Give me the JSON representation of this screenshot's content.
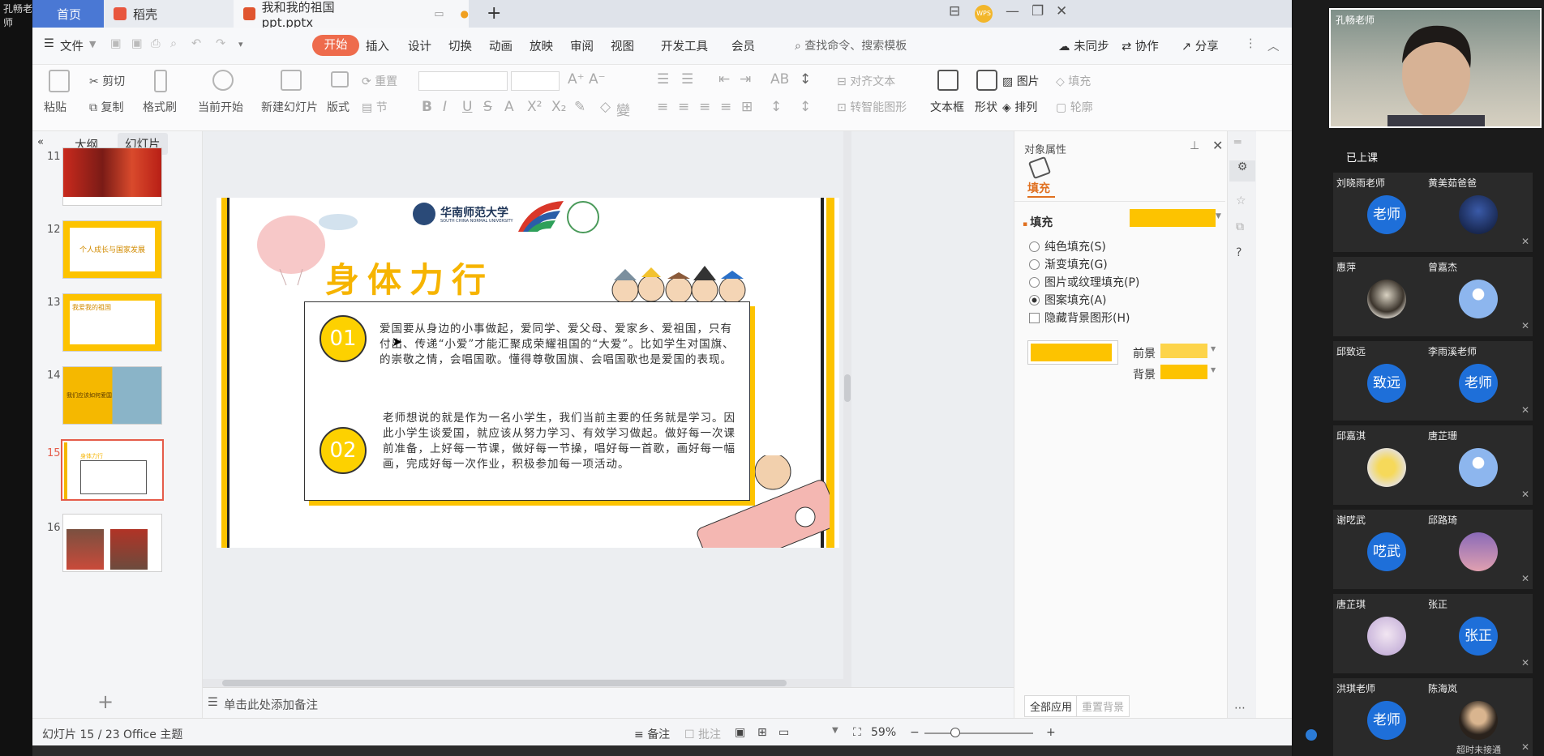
{
  "top_left_name": "孔畅老师",
  "tabs": {
    "home": "首页",
    "daoke": "稻壳",
    "doc": "我和我的祖国ppt.pptx",
    "add": "+"
  },
  "window_controls": {
    "layout": "⊟",
    "avatar": "WPS",
    "min": "—",
    "restore": "❐",
    "close": "✕"
  },
  "menu": {
    "file": "文件",
    "start": "开始",
    "items": [
      "插入",
      "设计",
      "切换",
      "动画",
      "放映",
      "审阅",
      "视图",
      "开发工具",
      "会员"
    ],
    "search": "查找命令、搜索模板",
    "sync": "未同步",
    "collab": "协作",
    "share": "分享"
  },
  "ribbon": {
    "paste": "粘贴",
    "cut": "剪切",
    "copy": "复制",
    "format_painter": "格式刷",
    "from_current": "当前开始",
    "new_slide": "新建幻灯片",
    "layout": "版式",
    "section": "节",
    "reset": "重置",
    "align_text": "对齐文本",
    "smart_art": "转智能图形",
    "textbox": "文本框",
    "shape": "形状",
    "picture": "图片",
    "arrange": "排列",
    "fill": "填充",
    "outline": "轮廓"
  },
  "left_panel": {
    "outline_tab": "大纲",
    "slides_tab": "幻灯片",
    "thumbs": [
      {
        "num": "11",
        "label": ""
      },
      {
        "num": "12",
        "label": "个人成长与国家发展"
      },
      {
        "num": "13",
        "label": "我爱我的祖国"
      },
      {
        "num": "14",
        "label": "我们应该如何爱国"
      },
      {
        "num": "15",
        "label": "身体力行"
      },
      {
        "num": "16",
        "label": ""
      }
    ]
  },
  "slide": {
    "university": "华南师范大学",
    "university_en": "SOUTH CHINA NORMAL UNIVERSITY",
    "title": "身体力行",
    "point1_num": "01",
    "point1_text": "爱国要从身边的小事做起，爱同学、爱父母、爱家乡、爱祖国，只有付出、传递“小爱”才能汇聚成荣耀祖国的“大爱”。比如学生对国旗、的崇敬之情，会唱国歌。懂得尊敬国旗、会唱国歌也是爱国的表现。",
    "point2_num": "02",
    "point2_text": "老师想说的就是作为一名小学生，我们当前主要的任务就是学习。因此小学生谈爱国，就应该从努力学习、有效学习做起。做好每一次课前准备，上好每一节课，做好每一节操，唱好每一首歌，画好每一幅画，完成好每一次作业，积极参加每一项活动。"
  },
  "notes_placeholder": "单击此处添加备注",
  "right_panel": {
    "title": "对象属性",
    "tab": "填充",
    "section": "填充",
    "options": [
      "纯色填充(S)",
      "渐变填充(G)",
      "图片或纹理填充(P)",
      "图案填充(A)"
    ],
    "selected_option": "图案填充(A)",
    "hide_bg": "隐藏背景图形(H)",
    "foreground": "前景",
    "background": "背景",
    "apply_all": "全部应用",
    "reset_bg": "重置背景",
    "fill_color": "#fdc300"
  },
  "status": {
    "slide_count": "幻灯片 15 / 23",
    "theme": "Office 主题",
    "notes": "备注",
    "comments": "批注",
    "zoom": "59%"
  },
  "meeting": {
    "self_name": "孔畅老师",
    "status": "已上课",
    "participants": [
      {
        "name": "刘晓雨老师",
        "avatar": "老师",
        "kind": "text"
      },
      {
        "name": "黄美茹爸爸",
        "avatar": "",
        "kind": "night"
      },
      {
        "name": "惠萍",
        "avatar": "",
        "kind": "silhouette"
      },
      {
        "name": "曾嘉杰",
        "avatar": "",
        "kind": "default"
      },
      {
        "name": "邱致远",
        "avatar": "致远",
        "kind": "text"
      },
      {
        "name": "李雨溪老师",
        "avatar": "老师",
        "kind": "text"
      },
      {
        "name": "邱嘉淇",
        "avatar": "",
        "kind": "child"
      },
      {
        "name": "唐芷珊",
        "avatar": "",
        "kind": "default"
      },
      {
        "name": "谢呓武",
        "avatar": "呓武",
        "kind": "text"
      },
      {
        "name": "邱路琦",
        "avatar": "",
        "kind": "sunset"
      },
      {
        "name": "唐芷琪",
        "avatar": "",
        "kind": "anime"
      },
      {
        "name": "张正",
        "avatar": "张正",
        "kind": "text"
      },
      {
        "name": "洪琪老师",
        "avatar": "老师",
        "kind": "text"
      },
      {
        "name": "陈海岚",
        "avatar": "",
        "kind": "girl"
      }
    ],
    "timeout_note": "超时未接通"
  }
}
